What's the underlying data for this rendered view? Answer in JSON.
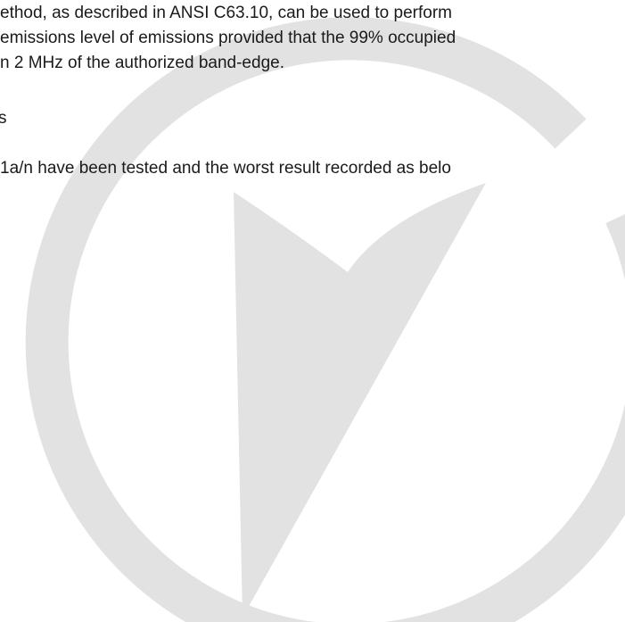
{
  "document": {
    "paragraph_1": [
      "ethod, as described in ANSI C63.10, can be used to perform",
      "emissions level of emissions provided that the 99% occupied",
      "n 2 MHz of the authorized band-edge."
    ],
    "fragment": "s",
    "paragraph_2": "1a/n have been tested and the worst result recorded as belo"
  },
  "watermark": {
    "icon": "circle-triangle-logo",
    "color": "#e2e2e2"
  }
}
